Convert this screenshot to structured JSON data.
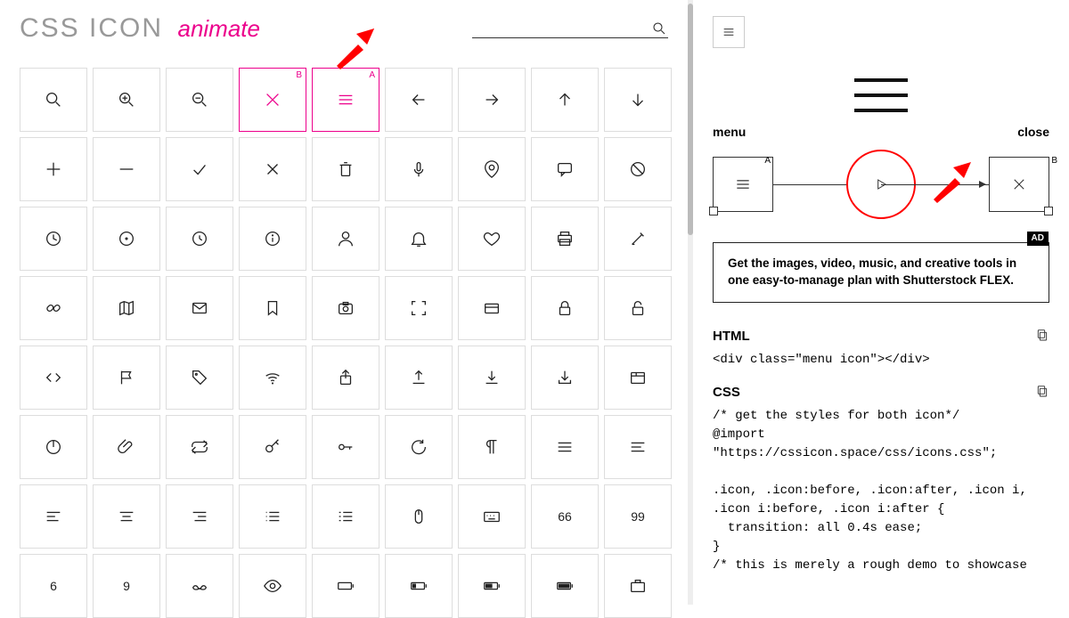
{
  "header": {
    "logo": "CSS ICON",
    "animate": "animate",
    "search_placeholder": ""
  },
  "selectedA": {
    "index": 4,
    "label": "A"
  },
  "selectedB": {
    "index": 3,
    "label": "B"
  },
  "panel": {
    "leftLabel": "menu",
    "rightLabel": "close",
    "cornerA": "A",
    "cornerB": "B",
    "adTag": "AD",
    "adText": "Get the images, video, music, and creative tools in one easy-to-manage plan with Shutterstock FLEX.",
    "htmlHead": "HTML",
    "htmlCode": "<div class=\"menu icon\"></div>",
    "cssHead": "CSS",
    "cssCode": "/* get the styles for both icon*/\n@import \"https://cssicon.space/css/icons.css\";\n\n.icon, .icon:before, .icon:after, .icon i, .icon i:before, .icon i:after {\n  transition: all 0.4s ease;\n}\n/* this is merely a rough demo to showcase"
  },
  "icons": [
    "magnify",
    "zoom-in",
    "zoom-out",
    "close",
    "menu",
    "arrow-left",
    "arrow-right",
    "arrow-up",
    "arrow-down",
    "plus",
    "minus",
    "check",
    "x",
    "trash",
    "mic",
    "pin",
    "comment",
    "ban",
    "clock",
    "target",
    "watch",
    "info",
    "user",
    "bell",
    "heart",
    "printer",
    "edit",
    "link",
    "map",
    "mail",
    "bookmark",
    "camera",
    "fullscreen",
    "card",
    "lock",
    "unlock",
    "code",
    "flag",
    "tag",
    "wifi",
    "share",
    "upload",
    "download",
    "download-alt",
    "tab",
    "power",
    "attach",
    "repeat",
    "key",
    "key-alt",
    "refresh",
    "pilcrow",
    "justify",
    "align",
    "align-left",
    "align-center",
    "align-right",
    "list",
    "list-alt",
    "mouse",
    "keyboard",
    "66",
    "99",
    "6",
    "9",
    "moustache",
    "eye",
    "battery-empty",
    "battery-low",
    "battery-mid",
    "battery-full",
    "briefcase"
  ]
}
